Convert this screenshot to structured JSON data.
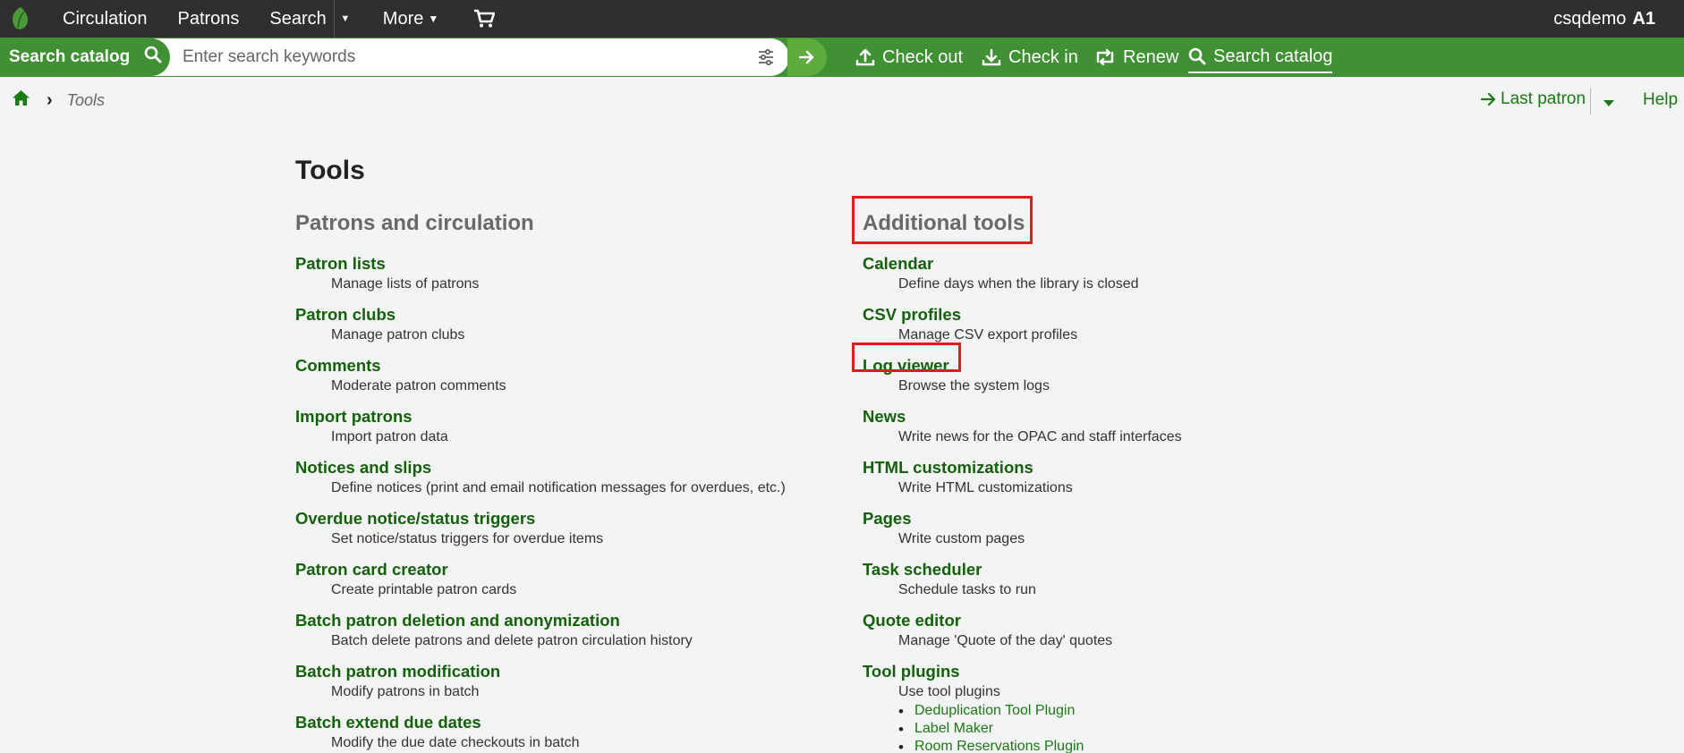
{
  "topnav": {
    "items": [
      "Circulation",
      "Patrons",
      "Search",
      "More"
    ],
    "user_name": "csqdemo",
    "user_branch": "A1"
  },
  "searchbar": {
    "label": "Search catalog",
    "placeholder": "Enter search keywords"
  },
  "quick_actions": [
    "Check out",
    "Check in",
    "Renew",
    "Search catalog"
  ],
  "breadcrumb": {
    "current": "Tools"
  },
  "header_right": {
    "last_patron": "Last patron",
    "help": "Help"
  },
  "page": {
    "title": "Tools",
    "patrons_section": {
      "heading": "Patrons and circulation",
      "items": [
        {
          "label": "Patron lists",
          "desc": "Manage lists of patrons"
        },
        {
          "label": "Patron clubs",
          "desc": "Manage patron clubs"
        },
        {
          "label": "Comments",
          "desc": "Moderate patron comments"
        },
        {
          "label": "Import patrons",
          "desc": "Import patron data"
        },
        {
          "label": "Notices and slips",
          "desc": "Define notices (print and email notification messages for overdues, etc.)"
        },
        {
          "label": "Overdue notice/status triggers",
          "desc": "Set notice/status triggers for overdue items"
        },
        {
          "label": "Patron card creator",
          "desc": "Create printable patron cards"
        },
        {
          "label": "Batch patron deletion and anonymization",
          "desc": "Batch delete patrons and delete patron circulation history"
        },
        {
          "label": "Batch patron modification",
          "desc": "Modify patrons in batch"
        },
        {
          "label": "Batch extend due dates",
          "desc": "Modify the due date checkouts in batch"
        }
      ]
    },
    "additional_section": {
      "heading": "Additional tools",
      "items": [
        {
          "label": "Calendar",
          "desc": "Define days when the library is closed"
        },
        {
          "label": "CSV profiles",
          "desc": "Manage CSV export profiles"
        },
        {
          "label": "Log viewer",
          "desc": "Browse the system logs"
        },
        {
          "label": "News",
          "desc": "Write news for the OPAC and staff interfaces"
        },
        {
          "label": "HTML customizations",
          "desc": "Write HTML customizations"
        },
        {
          "label": "Pages",
          "desc": "Write custom pages"
        },
        {
          "label": "Task scheduler",
          "desc": "Schedule tasks to run"
        },
        {
          "label": "Quote editor",
          "desc": "Manage 'Quote of the day' quotes"
        },
        {
          "label": "Tool plugins",
          "desc": "Use tool plugins"
        }
      ],
      "plugins": [
        "Deduplication Tool Plugin",
        "Label Maker",
        "Room Reservations Plugin"
      ]
    }
  },
  "colors": {
    "navbar": "#312e2e",
    "search_green": "#3f9134",
    "link_green": "#14610b",
    "highlight": "#e21b1b"
  }
}
